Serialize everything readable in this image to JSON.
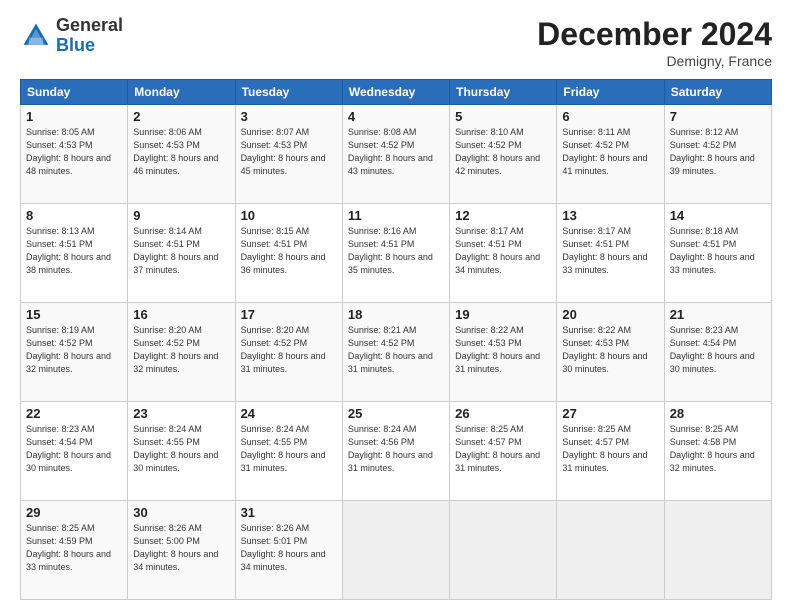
{
  "header": {
    "logo_general": "General",
    "logo_blue": "Blue",
    "month_title": "December 2024",
    "location": "Demigny, France"
  },
  "days_of_week": [
    "Sunday",
    "Monday",
    "Tuesday",
    "Wednesday",
    "Thursday",
    "Friday",
    "Saturday"
  ],
  "weeks": [
    [
      {
        "day": "1",
        "sunrise": "Sunrise: 8:05 AM",
        "sunset": "Sunset: 4:53 PM",
        "daylight": "Daylight: 8 hours and 48 minutes."
      },
      {
        "day": "2",
        "sunrise": "Sunrise: 8:06 AM",
        "sunset": "Sunset: 4:53 PM",
        "daylight": "Daylight: 8 hours and 46 minutes."
      },
      {
        "day": "3",
        "sunrise": "Sunrise: 8:07 AM",
        "sunset": "Sunset: 4:53 PM",
        "daylight": "Daylight: 8 hours and 45 minutes."
      },
      {
        "day": "4",
        "sunrise": "Sunrise: 8:08 AM",
        "sunset": "Sunset: 4:52 PM",
        "daylight": "Daylight: 8 hours and 43 minutes."
      },
      {
        "day": "5",
        "sunrise": "Sunrise: 8:10 AM",
        "sunset": "Sunset: 4:52 PM",
        "daylight": "Daylight: 8 hours and 42 minutes."
      },
      {
        "day": "6",
        "sunrise": "Sunrise: 8:11 AM",
        "sunset": "Sunset: 4:52 PM",
        "daylight": "Daylight: 8 hours and 41 minutes."
      },
      {
        "day": "7",
        "sunrise": "Sunrise: 8:12 AM",
        "sunset": "Sunset: 4:52 PM",
        "daylight": "Daylight: 8 hours and 39 minutes."
      }
    ],
    [
      {
        "day": "8",
        "sunrise": "Sunrise: 8:13 AM",
        "sunset": "Sunset: 4:51 PM",
        "daylight": "Daylight: 8 hours and 38 minutes."
      },
      {
        "day": "9",
        "sunrise": "Sunrise: 8:14 AM",
        "sunset": "Sunset: 4:51 PM",
        "daylight": "Daylight: 8 hours and 37 minutes."
      },
      {
        "day": "10",
        "sunrise": "Sunrise: 8:15 AM",
        "sunset": "Sunset: 4:51 PM",
        "daylight": "Daylight: 8 hours and 36 minutes."
      },
      {
        "day": "11",
        "sunrise": "Sunrise: 8:16 AM",
        "sunset": "Sunset: 4:51 PM",
        "daylight": "Daylight: 8 hours and 35 minutes."
      },
      {
        "day": "12",
        "sunrise": "Sunrise: 8:17 AM",
        "sunset": "Sunset: 4:51 PM",
        "daylight": "Daylight: 8 hours and 34 minutes."
      },
      {
        "day": "13",
        "sunrise": "Sunrise: 8:17 AM",
        "sunset": "Sunset: 4:51 PM",
        "daylight": "Daylight: 8 hours and 33 minutes."
      },
      {
        "day": "14",
        "sunrise": "Sunrise: 8:18 AM",
        "sunset": "Sunset: 4:51 PM",
        "daylight": "Daylight: 8 hours and 33 minutes."
      }
    ],
    [
      {
        "day": "15",
        "sunrise": "Sunrise: 8:19 AM",
        "sunset": "Sunset: 4:52 PM",
        "daylight": "Daylight: 8 hours and 32 minutes."
      },
      {
        "day": "16",
        "sunrise": "Sunrise: 8:20 AM",
        "sunset": "Sunset: 4:52 PM",
        "daylight": "Daylight: 8 hours and 32 minutes."
      },
      {
        "day": "17",
        "sunrise": "Sunrise: 8:20 AM",
        "sunset": "Sunset: 4:52 PM",
        "daylight": "Daylight: 8 hours and 31 minutes."
      },
      {
        "day": "18",
        "sunrise": "Sunrise: 8:21 AM",
        "sunset": "Sunset: 4:52 PM",
        "daylight": "Daylight: 8 hours and 31 minutes."
      },
      {
        "day": "19",
        "sunrise": "Sunrise: 8:22 AM",
        "sunset": "Sunset: 4:53 PM",
        "daylight": "Daylight: 8 hours and 31 minutes."
      },
      {
        "day": "20",
        "sunrise": "Sunrise: 8:22 AM",
        "sunset": "Sunset: 4:53 PM",
        "daylight": "Daylight: 8 hours and 30 minutes."
      },
      {
        "day": "21",
        "sunrise": "Sunrise: 8:23 AM",
        "sunset": "Sunset: 4:54 PM",
        "daylight": "Daylight: 8 hours and 30 minutes."
      }
    ],
    [
      {
        "day": "22",
        "sunrise": "Sunrise: 8:23 AM",
        "sunset": "Sunset: 4:54 PM",
        "daylight": "Daylight: 8 hours and 30 minutes."
      },
      {
        "day": "23",
        "sunrise": "Sunrise: 8:24 AM",
        "sunset": "Sunset: 4:55 PM",
        "daylight": "Daylight: 8 hours and 30 minutes."
      },
      {
        "day": "24",
        "sunrise": "Sunrise: 8:24 AM",
        "sunset": "Sunset: 4:55 PM",
        "daylight": "Daylight: 8 hours and 31 minutes."
      },
      {
        "day": "25",
        "sunrise": "Sunrise: 8:24 AM",
        "sunset": "Sunset: 4:56 PM",
        "daylight": "Daylight: 8 hours and 31 minutes."
      },
      {
        "day": "26",
        "sunrise": "Sunrise: 8:25 AM",
        "sunset": "Sunset: 4:57 PM",
        "daylight": "Daylight: 8 hours and 31 minutes."
      },
      {
        "day": "27",
        "sunrise": "Sunrise: 8:25 AM",
        "sunset": "Sunset: 4:57 PM",
        "daylight": "Daylight: 8 hours and 31 minutes."
      },
      {
        "day": "28",
        "sunrise": "Sunrise: 8:25 AM",
        "sunset": "Sunset: 4:58 PM",
        "daylight": "Daylight: 8 hours and 32 minutes."
      }
    ],
    [
      {
        "day": "29",
        "sunrise": "Sunrise: 8:25 AM",
        "sunset": "Sunset: 4:59 PM",
        "daylight": "Daylight: 8 hours and 33 minutes."
      },
      {
        "day": "30",
        "sunrise": "Sunrise: 8:26 AM",
        "sunset": "Sunset: 5:00 PM",
        "daylight": "Daylight: 8 hours and 34 minutes."
      },
      {
        "day": "31",
        "sunrise": "Sunrise: 8:26 AM",
        "sunset": "Sunset: 5:01 PM",
        "daylight": "Daylight: 8 hours and 34 minutes."
      },
      null,
      null,
      null,
      null
    ]
  ]
}
